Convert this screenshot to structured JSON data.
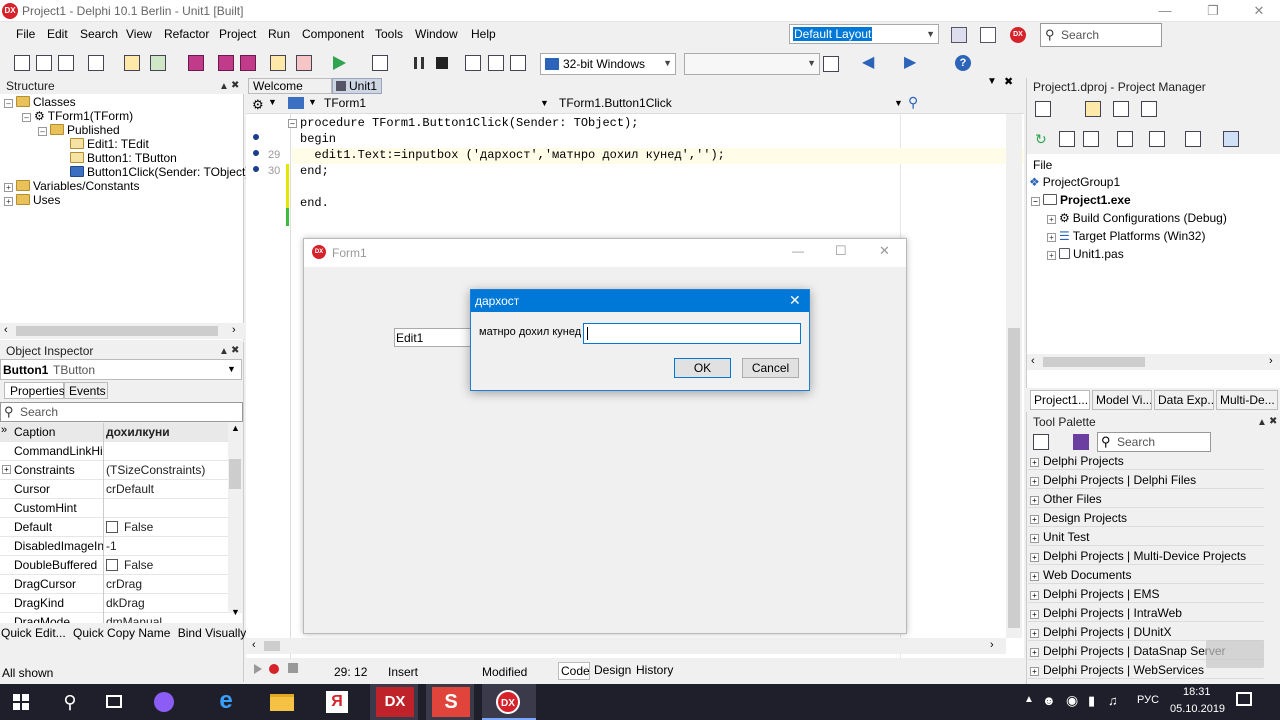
{
  "window": {
    "title": "Project1 - Delphi 10.1 Berlin - Unit1 [Built]",
    "logo": "DX"
  },
  "menu": [
    "File",
    "Edit",
    "Search",
    "View",
    "Refactor",
    "Project",
    "Run",
    "Component",
    "Tools",
    "Window",
    "Help"
  ],
  "layout_combo": "Default Layout",
  "search_top": {
    "placeholder": "Search"
  },
  "platform_combo": "32-bit Windows",
  "structure": {
    "title": "Structure",
    "items": [
      "Classes",
      "TForm1(TForm)",
      "Published",
      "Edit1: TEdit",
      "Button1: TButton",
      "Button1Click(Sender: TObject)",
      "Variables/Constants",
      "Uses"
    ]
  },
  "object_inspector": {
    "title": "Object Inspector",
    "object_name": "Button1",
    "object_type": "TButton",
    "tabs": [
      "Properties",
      "Events"
    ],
    "search_placeholder": "Search",
    "rows": [
      {
        "name": "Caption",
        "value": "дохилкуни"
      },
      {
        "name": "CommandLinkHint",
        "value": ""
      },
      {
        "name": "Constraints",
        "value": "(TSizeConstraints)"
      },
      {
        "name": "Cursor",
        "value": "crDefault"
      },
      {
        "name": "CustomHint",
        "value": ""
      },
      {
        "name": "Default",
        "value": "False"
      },
      {
        "name": "DisabledImageInd",
        "value": "-1"
      },
      {
        "name": "DoubleBuffered",
        "value": "False"
      },
      {
        "name": "DragCursor",
        "value": "crDrag"
      },
      {
        "name": "DragKind",
        "value": "dkDrag"
      },
      {
        "name": "DragMode",
        "value": "dmManual"
      }
    ],
    "links": [
      "Quick Edit...",
      "Quick Copy Name",
      "Bind Visually..."
    ],
    "footer": "All shown"
  },
  "editor": {
    "tabs": [
      "Welcome Page",
      "Unit1"
    ],
    "class_combo": "TForm1",
    "method_combo": "TForm1.Button1Click",
    "lines": [
      {
        "num": "",
        "text": "procedure TForm1.Button1Click(Sender: TObject);"
      },
      {
        "num": "",
        "text": "begin"
      },
      {
        "num": "29",
        "text": "  edit1.Text:=inputbox ('дархост','матнро дохил кунед','');"
      },
      {
        "num": "30",
        "text": "end;"
      },
      {
        "num": "",
        "text": ""
      },
      {
        "num": "",
        "text": "end."
      }
    ],
    "status": {
      "position": "29: 12",
      "mode": "Insert",
      "state": "Modified"
    },
    "bottom_tabs": [
      "Code",
      "Design",
      "History"
    ]
  },
  "form1": {
    "title": "Form1",
    "edit_text": "Edit1",
    "dialog": {
      "title": "дархост",
      "prompt": "матнро дохил кунед",
      "ok": "OK",
      "cancel": "Cancel"
    }
  },
  "project_manager": {
    "title": "Project1.dproj - Project Manager",
    "file_label": "File",
    "items": [
      "ProjectGroup1",
      "Project1.exe",
      "Build Configurations (Debug)",
      "Target Platforms (Win32)",
      "Unit1.pas"
    ],
    "tabs": [
      "Project1....",
      "Model Vi...",
      "Data Exp...",
      "Multi-De..."
    ]
  },
  "tool_palette": {
    "title": "Tool Palette",
    "search_placeholder": "Search",
    "categories": [
      "Delphi Projects",
      "Delphi Projects | Delphi Files",
      "Other Files",
      "Design Projects",
      "Unit Test",
      "Delphi Projects | Multi-Device Projects",
      "Web Documents",
      "Delphi Projects | EMS",
      "Delphi Projects | IntraWeb",
      "Delphi Projects | DUnitX",
      "Delphi Projects | DataSnap Server",
      "Delphi Projects | WebServices"
    ]
  },
  "taskbar": {
    "lang": "РУС",
    "time": "18:31",
    "date": "05.10.2019",
    "apps": [
      "windows-start-icon",
      "search-icon",
      "task-view-icon",
      "app-icon",
      "edge-icon",
      "explorer-icon",
      "yandex-icon",
      "delphi-icon",
      "sublime-icon",
      "delphi-active-icon"
    ]
  },
  "colors": {
    "accent": "#0078d7",
    "delphi_red": "#d6232b",
    "taskbar": "#1f1f2b"
  }
}
